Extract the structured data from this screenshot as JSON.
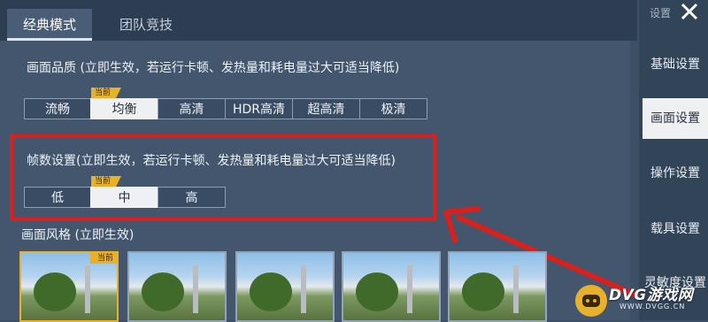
{
  "tabs": [
    {
      "label": "经典模式"
    },
    {
      "label": "团队竞技"
    }
  ],
  "quality": {
    "title": "画面品质 (立即生效，若运行卡顿、发热量和耗电量过大可适当降低)",
    "current_tag": "当前",
    "options": [
      "流畅",
      "均衡",
      "高清",
      "HDR高清",
      "超高清",
      "极清"
    ],
    "selected": "均衡"
  },
  "framerate": {
    "title": "帧数设置(立即生效，若运行卡顿、发热量和耗电量过大可适当降低)",
    "current_tag": "当前",
    "options": [
      "低",
      "中",
      "高"
    ],
    "selected": "中"
  },
  "style": {
    "title": "画面风格 (立即生效)",
    "current_tag": "当前",
    "thumb_count": 5
  },
  "sidebar": {
    "title": "设置",
    "items": [
      {
        "label": "基础设置"
      },
      {
        "label": "画面设置"
      },
      {
        "label": "操作设置"
      },
      {
        "label": "载具设置"
      },
      {
        "label": "灵敏度设置"
      }
    ],
    "selected": "画面设置"
  },
  "icons": {
    "close": "close-icon"
  },
  "colors": {
    "accent": "#e8b12c",
    "highlight": "#d9201d",
    "panel": "#43566e"
  },
  "watermark": {
    "text": "DVG游戏网",
    "sub": "WWW.DVGG.CN"
  }
}
